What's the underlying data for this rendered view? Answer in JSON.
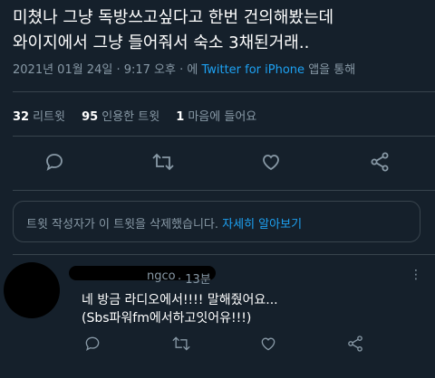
{
  "tweet": {
    "line1": "미쳤나 그냥 독방쓰고싶다고 한번 건의해봤는데",
    "line2": "와이지에서 그냥 들어줘서 숙소 3채된거래..",
    "date": "2021년 01월 24일 · 9:17 오후 · 에",
    "source": "Twitter for iPhone",
    "source_suffix": "앱을 통해"
  },
  "stats": {
    "retweets_count": "32",
    "retweets_label": "리트윗",
    "quotes_count": "95",
    "quotes_label": "인용한 트윗",
    "likes_count": "1",
    "likes_label": "마음에 들어요"
  },
  "actions": {
    "icons": [
      "reply-icon",
      "retweet-icon",
      "like-icon",
      "share-icon"
    ]
  },
  "notice": {
    "text": "트윗 작성자가 이 트윗을 삭제했습니다.",
    "link": "자세히 알아보기"
  },
  "reply": {
    "handle_visible": "ngco",
    "time": "· 13분",
    "more": "⋮",
    "line1": "네 방금 라디오에서!!!! 말해줬어요...",
    "line2": "(Sbs파워fm에서하고잇어유!!!)"
  },
  "colors": {
    "background": "#15202b",
    "accent": "#1da1f2",
    "secondary_text": "#8899a6",
    "divider": "#38444d"
  }
}
